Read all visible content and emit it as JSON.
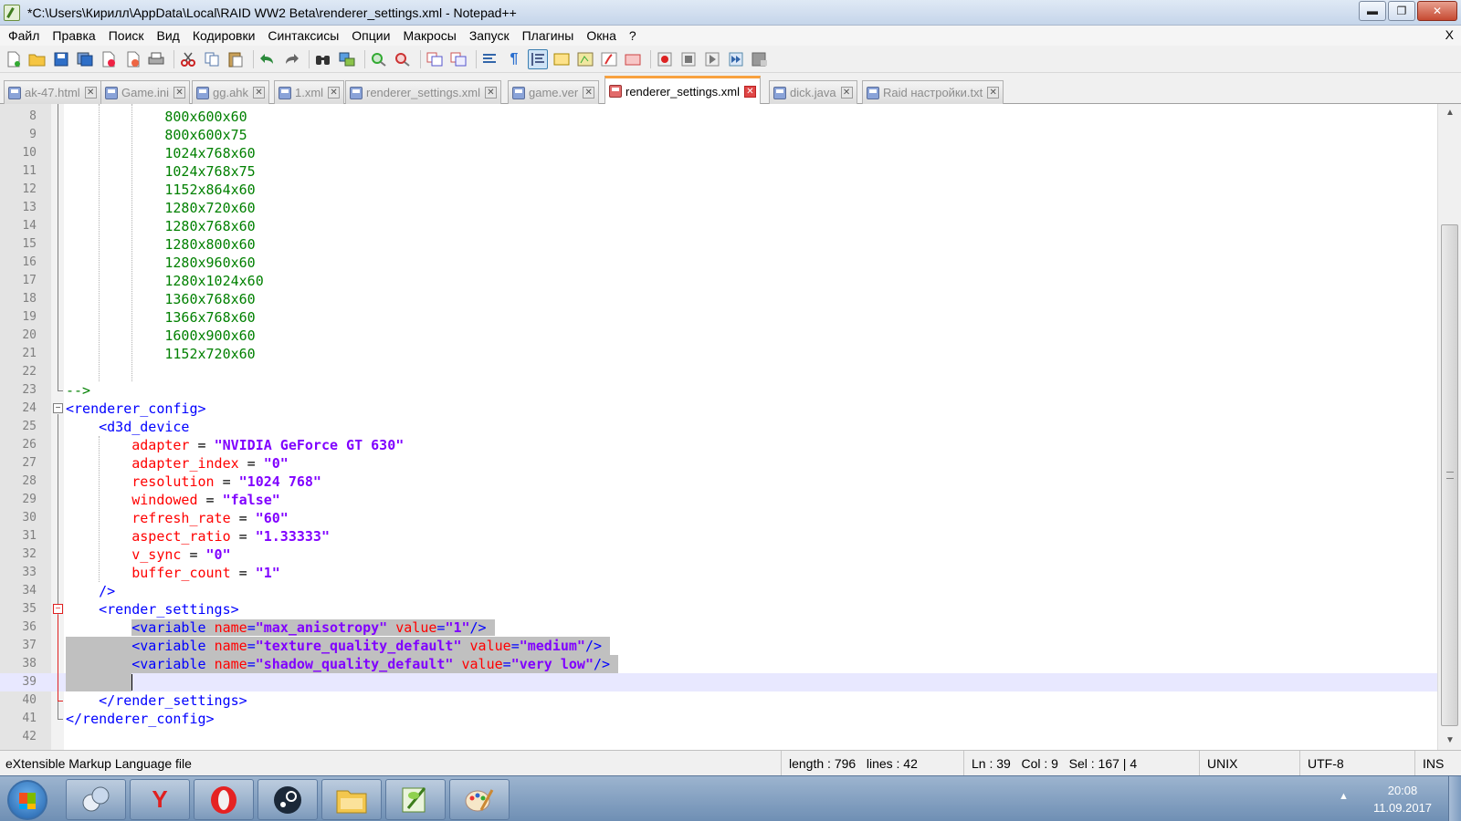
{
  "window": {
    "title": "*C:\\Users\\Кирилл\\AppData\\Local\\RAID WW2 Beta\\renderer_settings.xml - Notepad++",
    "buttons": {
      "minimize": "▬",
      "maximize": "❐",
      "close": "✕"
    }
  },
  "menu": {
    "items": [
      "Файл",
      "Правка",
      "Поиск",
      "Вид",
      "Кодировки",
      "Синтаксисы",
      "Опции",
      "Макросы",
      "Запуск",
      "Плагины",
      "Окна",
      "?"
    ],
    "close": "X"
  },
  "tabs": [
    {
      "label": "ak-47.html",
      "active": false
    },
    {
      "label": "Game.ini",
      "active": false
    },
    {
      "label": "gg.ahk",
      "active": false
    },
    {
      "label": "1.xml",
      "active": false
    },
    {
      "label": "renderer_settings.xml",
      "active": false
    },
    {
      "label": "game.ver",
      "active": false
    },
    {
      "label": "renderer_settings.xml",
      "active": true
    },
    {
      "label": "dick.java",
      "active": false
    },
    {
      "label": "Raid настройки.txt",
      "active": false
    }
  ],
  "editor": {
    "lines": [
      {
        "n": "8",
        "segs": [
          [
            "val",
            "800x600x60"
          ]
        ],
        "indent": 3
      },
      {
        "n": "9",
        "segs": [
          [
            "val",
            "800x600x75"
          ]
        ],
        "indent": 3
      },
      {
        "n": "10",
        "segs": [
          [
            "val",
            "1024x768x60"
          ]
        ],
        "indent": 3
      },
      {
        "n": "11",
        "segs": [
          [
            "val",
            "1024x768x75"
          ]
        ],
        "indent": 3
      },
      {
        "n": "12",
        "segs": [
          [
            "val",
            "1152x864x60"
          ]
        ],
        "indent": 3
      },
      {
        "n": "13",
        "segs": [
          [
            "val",
            "1280x720x60"
          ]
        ],
        "indent": 3
      },
      {
        "n": "14",
        "segs": [
          [
            "val",
            "1280x768x60"
          ]
        ],
        "indent": 3
      },
      {
        "n": "15",
        "segs": [
          [
            "val",
            "1280x800x60"
          ]
        ],
        "indent": 3
      },
      {
        "n": "16",
        "segs": [
          [
            "val",
            "1280x960x60"
          ]
        ],
        "indent": 3
      },
      {
        "n": "17",
        "segs": [
          [
            "val",
            "1280x1024x60"
          ]
        ],
        "indent": 3
      },
      {
        "n": "18",
        "segs": [
          [
            "val",
            "1360x768x60"
          ]
        ],
        "indent": 3
      },
      {
        "n": "19",
        "segs": [
          [
            "val",
            "1366x768x60"
          ]
        ],
        "indent": 3
      },
      {
        "n": "20",
        "segs": [
          [
            "val",
            "1600x900x60"
          ]
        ],
        "indent": 3
      },
      {
        "n": "21",
        "segs": [
          [
            "val",
            "1152x720x60"
          ]
        ],
        "indent": 3
      },
      {
        "n": "22",
        "segs": [],
        "indent": 0
      },
      {
        "n": "23",
        "segs": [
          [
            "cmt",
            "-->"
          ]
        ],
        "indent": 0
      },
      {
        "n": "24",
        "segs": [
          [
            "tag",
            "<renderer_config>"
          ]
        ],
        "indent": 0
      },
      {
        "n": "25",
        "segs": [
          [
            "tag",
            "<d3d_device"
          ]
        ],
        "indent": 1
      },
      {
        "n": "26",
        "segs": [
          [
            "attr",
            "adapter"
          ],
          [
            "",
            " = "
          ],
          [
            "str",
            "\"NVIDIA GeForce GT 630\""
          ]
        ],
        "indent": 2
      },
      {
        "n": "27",
        "segs": [
          [
            "attr",
            "adapter_index"
          ],
          [
            "",
            " = "
          ],
          [
            "str",
            "\"0\""
          ]
        ],
        "indent": 2
      },
      {
        "n": "28",
        "segs": [
          [
            "attr",
            "resolution"
          ],
          [
            "",
            " = "
          ],
          [
            "str",
            "\"1024 768\""
          ]
        ],
        "indent": 2
      },
      {
        "n": "29",
        "segs": [
          [
            "attr",
            "windowed"
          ],
          [
            "",
            " = "
          ],
          [
            "str",
            "\"false\""
          ]
        ],
        "indent": 2
      },
      {
        "n": "30",
        "segs": [
          [
            "attr",
            "refresh_rate"
          ],
          [
            "",
            " = "
          ],
          [
            "str",
            "\"60\""
          ]
        ],
        "indent": 2
      },
      {
        "n": "31",
        "segs": [
          [
            "attr",
            "aspect_ratio"
          ],
          [
            "",
            " = "
          ],
          [
            "str",
            "\"1.33333\""
          ]
        ],
        "indent": 2
      },
      {
        "n": "32",
        "segs": [
          [
            "attr",
            "v_sync"
          ],
          [
            "",
            " = "
          ],
          [
            "str",
            "\"0\""
          ]
        ],
        "indent": 2
      },
      {
        "n": "33",
        "segs": [
          [
            "attr",
            "buffer_count"
          ],
          [
            "",
            " = "
          ],
          [
            "str",
            "\"1\""
          ]
        ],
        "indent": 2
      },
      {
        "n": "34",
        "segs": [
          [
            "tag",
            "/>"
          ]
        ],
        "indent": 1
      },
      {
        "n": "35",
        "segs": [
          [
            "tag",
            "<render_settings>"
          ]
        ],
        "indent": 1
      },
      {
        "n": "36",
        "segs": [
          [
            "tag",
            "<variable "
          ],
          [
            "attr",
            "name"
          ],
          [
            "tag",
            "="
          ],
          [
            "str",
            "\"max_anisotropy\""
          ],
          [
            "",
            " "
          ],
          [
            "attr",
            "value"
          ],
          [
            "tag",
            "="
          ],
          [
            "str",
            "\"1\""
          ],
          [
            "tag",
            "/>"
          ]
        ],
        "indent": 2
      },
      {
        "n": "37",
        "segs": [
          [
            "tag",
            "<variable "
          ],
          [
            "attr",
            "name"
          ],
          [
            "tag",
            "="
          ],
          [
            "str",
            "\"texture_quality_default\""
          ],
          [
            "",
            " "
          ],
          [
            "attr",
            "value"
          ],
          [
            "tag",
            "="
          ],
          [
            "str",
            "\"medium\""
          ],
          [
            "tag",
            "/>"
          ]
        ],
        "indent": 2
      },
      {
        "n": "38",
        "segs": [
          [
            "tag",
            "<variable "
          ],
          [
            "attr",
            "name"
          ],
          [
            "tag",
            "="
          ],
          [
            "str",
            "\"shadow_quality_default\""
          ],
          [
            "",
            " "
          ],
          [
            "attr",
            "value"
          ],
          [
            "tag",
            "="
          ],
          [
            "str",
            "\"very low\""
          ],
          [
            "tag",
            "/>"
          ]
        ],
        "indent": 2
      },
      {
        "n": "39",
        "segs": [],
        "indent": 0
      },
      {
        "n": "40",
        "segs": [
          [
            "tag",
            "</render_settings>"
          ]
        ],
        "indent": 1
      },
      {
        "n": "41",
        "segs": [
          [
            "tag",
            "</renderer_config>"
          ]
        ],
        "indent": 0
      },
      {
        "n": "42",
        "segs": [],
        "indent": 0
      }
    ]
  },
  "status": {
    "filetype": "eXtensible Markup Language file",
    "length": "length : 796",
    "lines": "lines : 42",
    "ln": "Ln : 39",
    "col": "Col : 9",
    "sel": "Sel : 167 | 4",
    "eol": "UNIX",
    "encoding": "UTF-8",
    "mode": "INS"
  },
  "taskbar": {
    "apps": [
      "network-icon",
      "yandex-icon",
      "opera-icon",
      "steam-icon",
      "explorer-icon",
      "notepadpp-icon",
      "paint-icon"
    ],
    "yandex_label": "Y",
    "opera_label": "O",
    "tray_arrow": "▲",
    "time": "20:08",
    "date": "11.09.2017"
  },
  "colors": {
    "tag": "#0000ff",
    "attr": "#ff0000",
    "string": "#8000ff",
    "value": "#008000",
    "selection": "#c0c0c0",
    "active_tab_accent": "#f8a13e"
  }
}
